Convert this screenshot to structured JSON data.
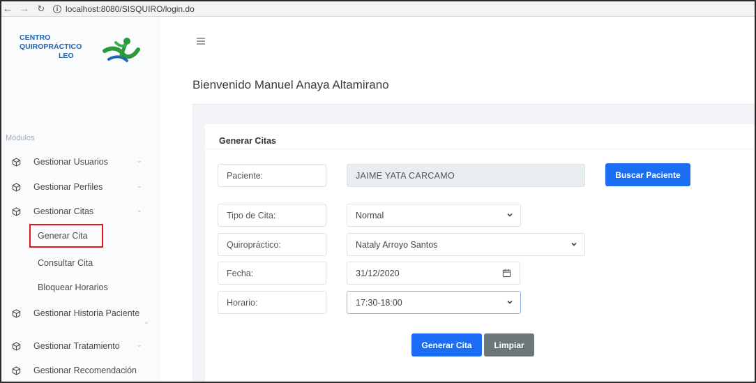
{
  "browser": {
    "url": "localhost:8080/SISQUIRO/login.do"
  },
  "logo": {
    "line1": "CENTRO",
    "line2": "QUIROPRÁCTICO",
    "line3": "LEO"
  },
  "sidebar": {
    "section_label": "Módulos",
    "items": [
      {
        "label": "Gestionar Usuarios"
      },
      {
        "label": "Gestionar Perfiles"
      },
      {
        "label": "Gestionar Citas"
      },
      {
        "label": "Gestionar Historia Paciente"
      },
      {
        "label": "Gestionar Tratamiento"
      },
      {
        "label": "Gestionar Recomendación"
      }
    ],
    "sub_items": [
      {
        "label": "Generar Cita"
      },
      {
        "label": "Consultar Cita"
      },
      {
        "label": "Bloquear Horarios"
      }
    ]
  },
  "main": {
    "welcome": "Bienvenido Manuel Anaya Altamirano",
    "card_title": "Generar Citas",
    "form": {
      "paciente_label": "Paciente:",
      "paciente_value": "JAIME  YATA CARCAMO",
      "tipo_label": "Tipo de Cita:",
      "tipo_value": "Normal",
      "quiro_label": "Quiropráctico:",
      "quiro_value": "Nataly Arroyo Santos",
      "fecha_label": "Fecha:",
      "fecha_value": "31/12/2020",
      "horario_label": "Horario:",
      "horario_value": "17:30-18:00"
    },
    "buttons": {
      "buscar": "Buscar Paciente",
      "generar": "Generar Cita",
      "limpiar": "Limpiar"
    }
  },
  "colors": {
    "primary": "#1b6ef3",
    "secondary": "#6c777b",
    "logo_blue": "#1f65b5",
    "highlight_red": "#e0191d"
  }
}
